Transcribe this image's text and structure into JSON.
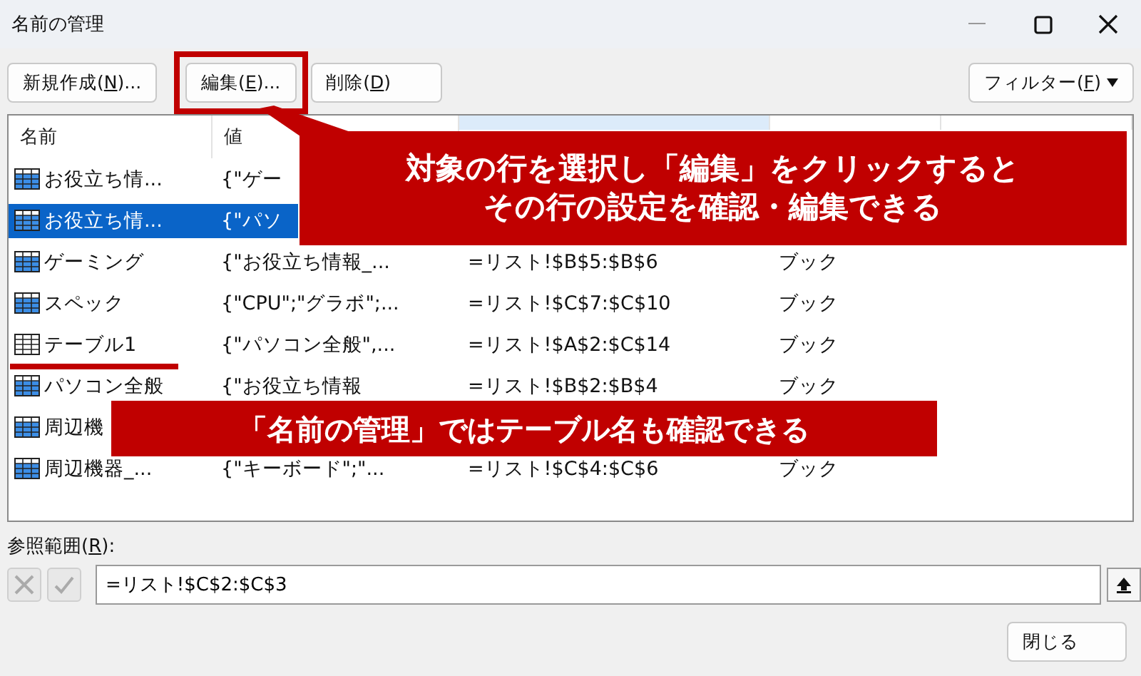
{
  "window": {
    "title": "名前の管理"
  },
  "toolbar": {
    "buttons": [
      {
        "before": "新規作成(",
        "key": "N",
        "after": ")...",
        "highlighted": false
      },
      {
        "before": "編集(",
        "key": "E",
        "after": ")...",
        "highlighted": true
      },
      {
        "before": "削除(",
        "key": "D",
        "after": ")",
        "highlighted": false
      }
    ],
    "filter": {
      "before": "フィルター(",
      "key": "F",
      "after": ")"
    }
  },
  "table": {
    "columns": [
      {
        "label": "名前",
        "sorted": false
      },
      {
        "label": "値",
        "sorted": false
      },
      {
        "sorted": true
      },
      {
        "sorted": false
      },
      {
        "sorted": false
      }
    ],
    "rows": [
      {
        "kind": "name",
        "selected": false,
        "cells": [
          "お役立ち情...",
          "{\"ゲー",
          "",
          "",
          ""
        ]
      },
      {
        "kind": "name",
        "selected": true,
        "cells": [
          "お役立ち情...",
          "{\"パソ",
          "",
          "",
          ""
        ]
      },
      {
        "kind": "name",
        "selected": false,
        "cells": [
          "ゲーミング",
          "{\"お役立ち情報_...",
          "=リスト!$B$5:$B$6",
          "ブック",
          ""
        ]
      },
      {
        "kind": "name",
        "selected": false,
        "cells": [
          "スペック",
          "{\"CPU\";\"グラボ\";...",
          "=リスト!$C$7:$C$10",
          "ブック",
          ""
        ]
      },
      {
        "kind": "table",
        "selected": false,
        "cells": [
          "テーブル1",
          "{\"パソコン全般\",...",
          "=リスト!$A$2:$C$14",
          "ブック",
          ""
        ]
      },
      {
        "kind": "name",
        "selected": false,
        "cells": [
          "パソコン全般",
          "{\"お役立ち情報",
          "=リスト!$B$2:$B$4",
          "ブック",
          ""
        ]
      },
      {
        "kind": "name",
        "selected": false,
        "cells": [
          "周辺機",
          "",
          "",
          "",
          ""
        ]
      },
      {
        "kind": "name",
        "selected": false,
        "cells": [
          "周辺機器_...",
          "{\"キーボード\";\"...",
          "=リスト!$C$4:$C$6",
          "ブック",
          ""
        ]
      }
    ]
  },
  "reference": {
    "before": "参照範囲(",
    "key": "R",
    "after": "):",
    "value": "=リスト!$C$2:$C$3"
  },
  "close_button": "閉じる",
  "callouts": [
    {
      "lines": [
        "対象の行を選択し「編集」をクリックすると",
        "その行の設定を確認・編集できる"
      ]
    },
    {
      "lines": [
        "「名前の管理」ではテーブル名も確認できる"
      ]
    }
  ]
}
